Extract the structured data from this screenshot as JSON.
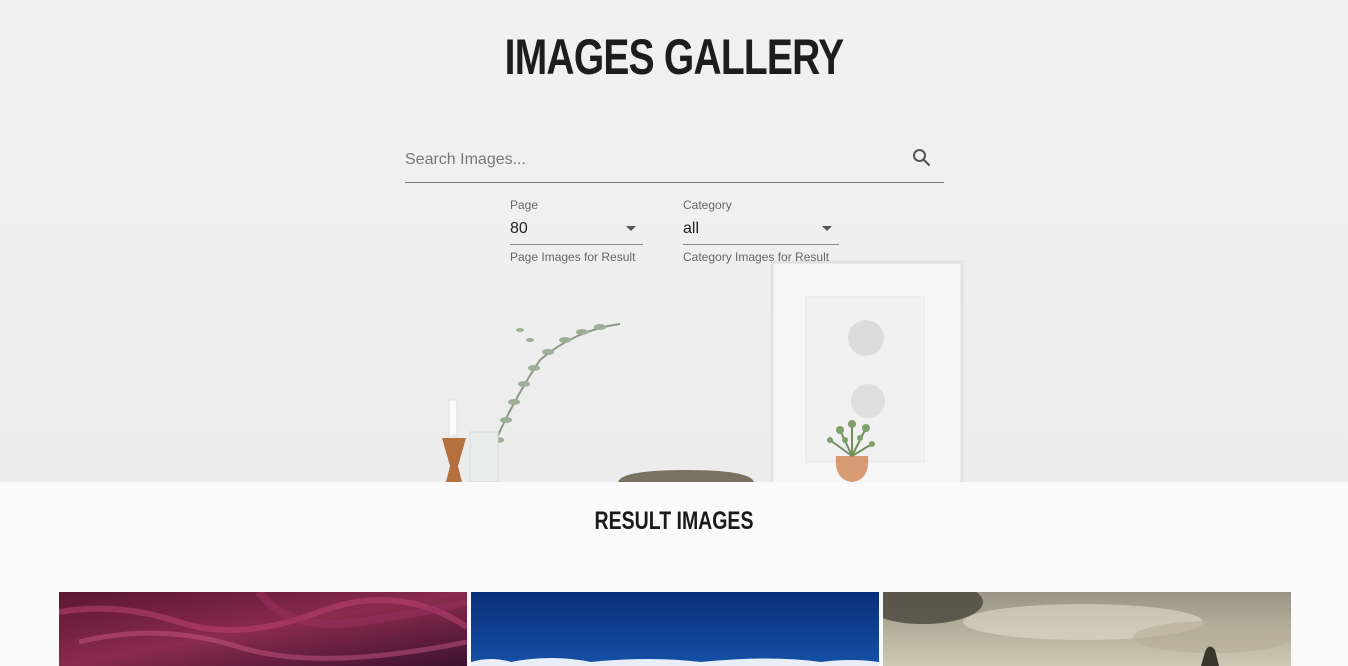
{
  "header": {
    "title": "IMAGES GALLERY"
  },
  "search": {
    "placeholder": "Search Images...",
    "value": ""
  },
  "page_select": {
    "label": "Page",
    "value": "80",
    "helper": "Page Images for Result"
  },
  "category_select": {
    "label": "Category",
    "value": "all",
    "helper": "Category Images for Result"
  },
  "results": {
    "title": "RESULT IMAGES"
  },
  "icons": {
    "search": "search-icon",
    "dropdown": "caret-down-icon"
  },
  "colors": {
    "title_text": "#1d1d1d",
    "hero_bg": "#efefef",
    "page_bg": "#fafafa"
  }
}
